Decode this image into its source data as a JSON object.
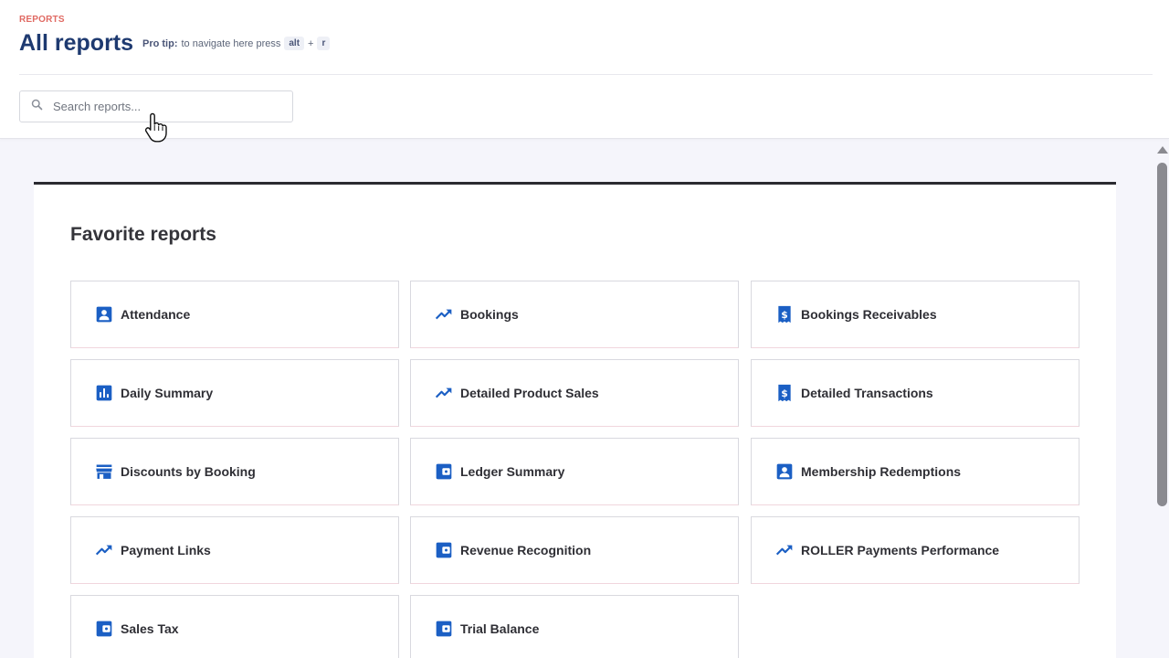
{
  "header": {
    "eyebrow": "REPORTS",
    "title": "All reports",
    "protip_label": "Pro tip:",
    "protip_text": "to navigate here press",
    "key1": "alt",
    "plus": "+",
    "key2": "r"
  },
  "search": {
    "placeholder": "Search reports...",
    "value": ""
  },
  "favorites": {
    "title": "Favorite reports",
    "items": [
      {
        "label": "Attendance",
        "icon": "account-box-icon"
      },
      {
        "label": "Bookings",
        "icon": "trending-up-icon"
      },
      {
        "label": "Bookings Receivables",
        "icon": "receipt-dollar-icon"
      },
      {
        "label": "Daily Summary",
        "icon": "bar-chart-icon"
      },
      {
        "label": "Detailed Product Sales",
        "icon": "trending-up-icon"
      },
      {
        "label": "Detailed Transactions",
        "icon": "receipt-dollar-icon"
      },
      {
        "label": "Discounts by Booking",
        "icon": "storefront-icon"
      },
      {
        "label": "Ledger Summary",
        "icon": "wallet-icon"
      },
      {
        "label": "Membership Redemptions",
        "icon": "account-box-icon"
      },
      {
        "label": "Payment Links",
        "icon": "trending-up-icon"
      },
      {
        "label": "Revenue Recognition",
        "icon": "wallet-icon"
      },
      {
        "label": "ROLLER Payments Performance",
        "icon": "trending-up-icon"
      },
      {
        "label": "Sales Tax",
        "icon": "wallet-icon"
      },
      {
        "label": "Trial Balance",
        "icon": "wallet-icon"
      }
    ]
  },
  "colors": {
    "accent": "#1b5fc4",
    "title": "#1e3a70",
    "eyebrow": "#e06a63"
  }
}
